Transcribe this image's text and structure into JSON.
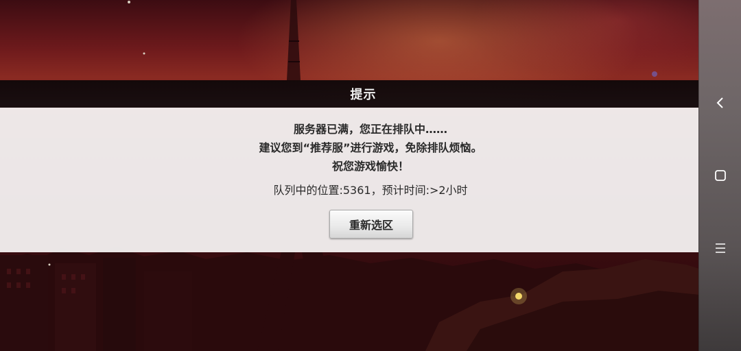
{
  "dialog": {
    "title": "提示",
    "message_lines": [
      "服务器已满，您正在排队中……",
      "建议您到“推荐服”进行游戏，免除排队烦恼。",
      "祝您游戏愉快！"
    ],
    "queue_status": "队列中的位置:5361，预计时间:>2小时",
    "reselect_button": "重新选区"
  },
  "navbar": {
    "icons": [
      "back-icon",
      "home-icon",
      "menu-icon"
    ]
  },
  "colors": {
    "sky_top": "#3c0c12",
    "sky_glow": "#8a2a22",
    "dialog_body": "#f4f2f2",
    "dialog_header": "#0a0608",
    "navbar": "#6e6667"
  }
}
